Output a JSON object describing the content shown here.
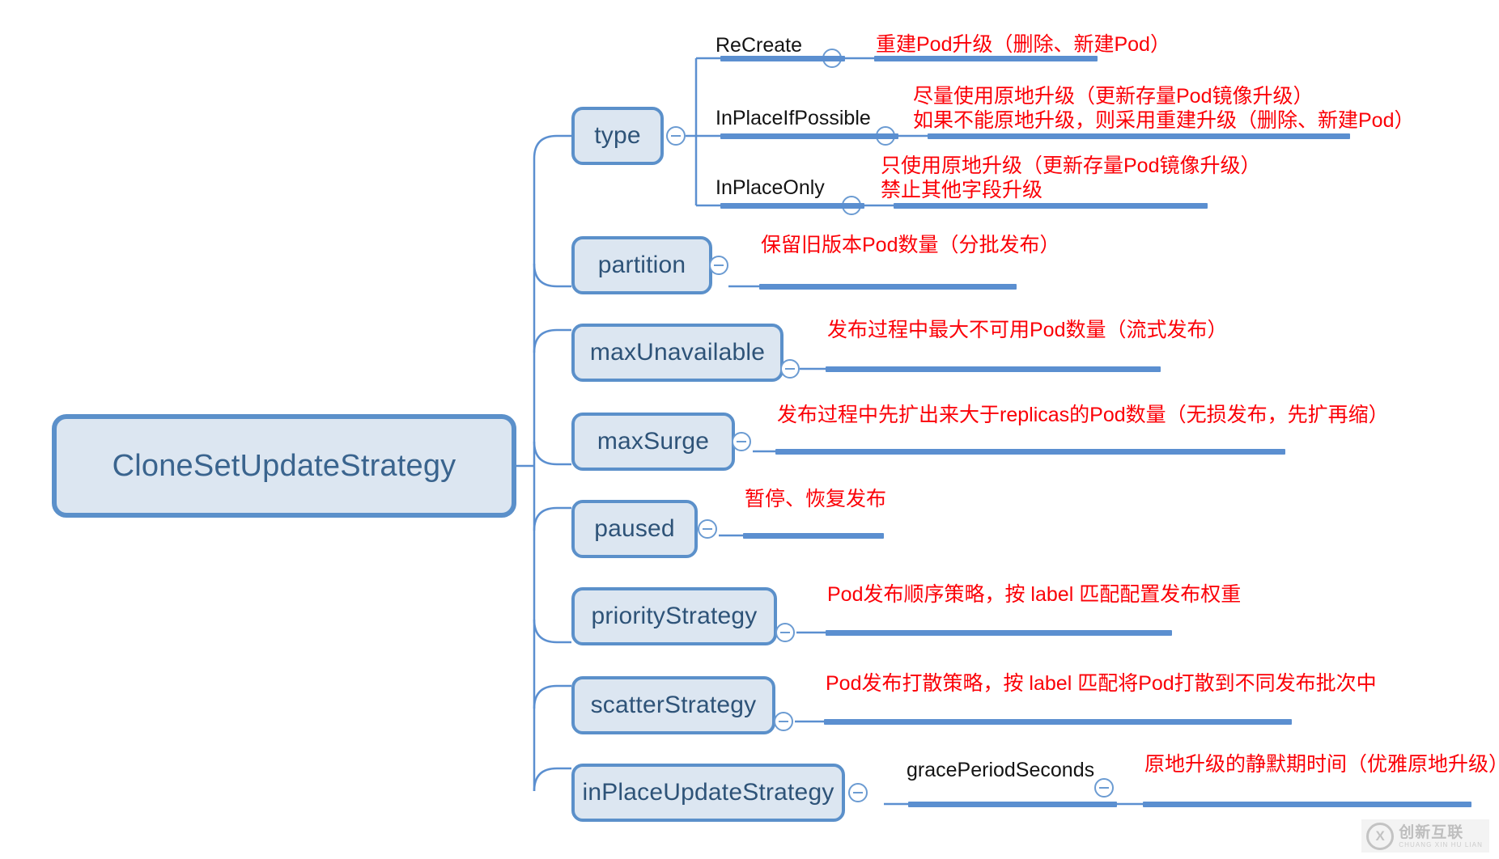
{
  "diagram": {
    "type": "mind-map",
    "root": {
      "label": "CloneSetUpdateStrategy"
    },
    "colors": {
      "node_fill": "#dce6f1",
      "node_border": "#5b90ca",
      "node_text": "#2e5378",
      "annotation_text": "#fb0007",
      "connector": "#5b8fd0",
      "background": "#ffffff"
    },
    "branches": [
      {
        "label": "type",
        "annotation": "",
        "children": [
          {
            "label": "ReCreate",
            "annotation_line1": "重建Pod升级（删除、新建Pod）",
            "annotation_line2": ""
          },
          {
            "label": "InPlaceIfPossible",
            "annotation_line1": "尽量使用原地升级（更新存量Pod镜像升级）",
            "annotation_line2": "如果不能原地升级，则采用重建升级（删除、新建Pod）"
          },
          {
            "label": "InPlaceOnly",
            "annotation_line1": "只使用原地升级（更新存量Pod镜像升级）",
            "annotation_line2": "禁止其他字段升级"
          }
        ]
      },
      {
        "label": "partition",
        "annotation_line1": "保留旧版本Pod数量（分批发布）",
        "annotation_line2": "",
        "children": []
      },
      {
        "label": "maxUnavailable",
        "annotation_line1": "发布过程中最大不可用Pod数量（流式发布）",
        "annotation_line2": "",
        "children": []
      },
      {
        "label": "maxSurge",
        "annotation_line1": "发布过程中先扩出来大于replicas的Pod数量（无损发布，先扩再缩）",
        "annotation_line2": "",
        "children": []
      },
      {
        "label": "paused",
        "annotation_line1": "暂停、恢复发布",
        "annotation_line2": "",
        "children": []
      },
      {
        "label": "priorityStrategy",
        "annotation_line1": "Pod发布顺序策略，按 label 匹配配置发布权重",
        "annotation_line2": "",
        "children": []
      },
      {
        "label": "scatterStrategy",
        "annotation_line1": "Pod发布打散策略，按 label 匹配将Pod打散到不同发布批次中",
        "annotation_line2": "",
        "children": []
      },
      {
        "label": "inPlaceUpdateStrategy",
        "annotation_line1": "",
        "annotation_line2": "",
        "children": [
          {
            "label": "gracePeriodSeconds",
            "annotation_line1": "原地升级的静默期时间（优雅原地升级）",
            "annotation_line2": ""
          }
        ]
      }
    ]
  },
  "watermark": {
    "mark": "X",
    "cn": "创新互联",
    "en": "CHUANG XIN HU LIAN"
  }
}
